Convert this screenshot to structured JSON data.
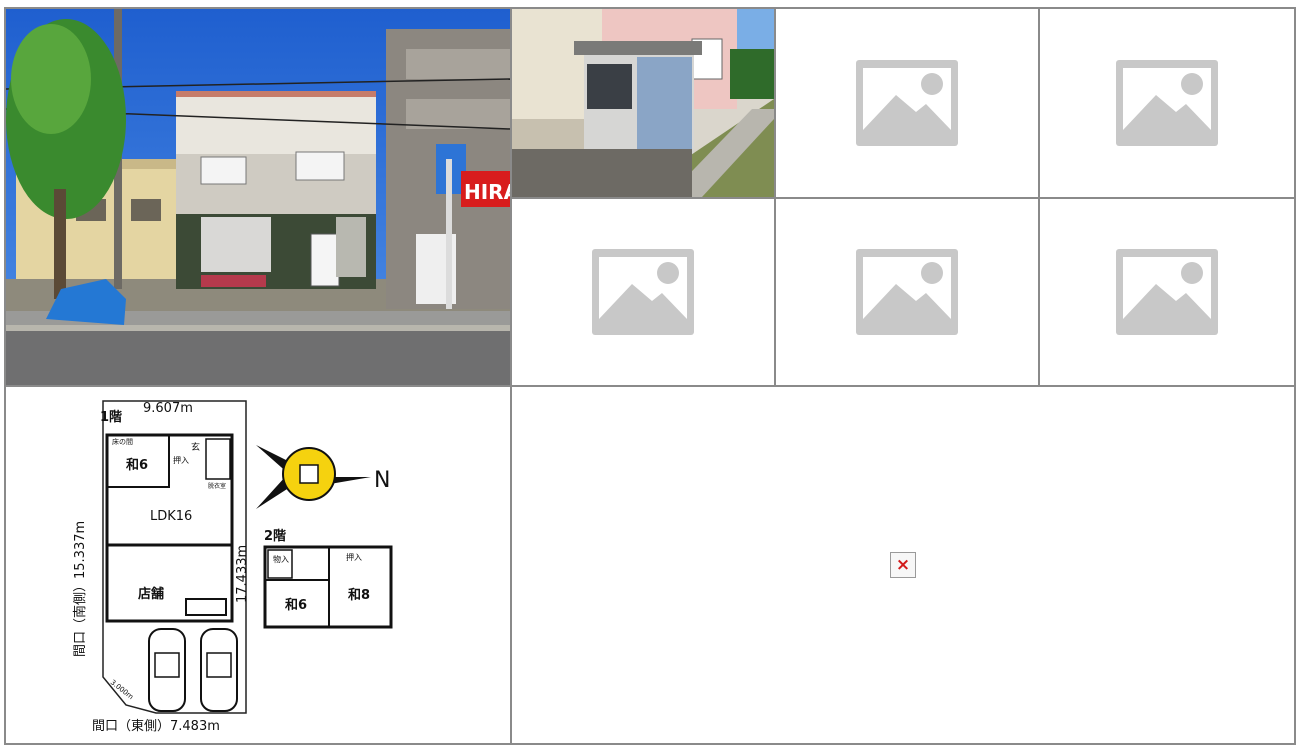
{
  "gallery": {
    "main_photo": {
      "alt": "building exterior photo",
      "signage": "HIRA"
    },
    "thumb_photo": {
      "alt": "side yard storage shed photo"
    },
    "placeholder_count": 5
  },
  "floor_plan": {
    "floor1_label": "1階",
    "floor2_label": "2階",
    "top_width": "9.607m",
    "left_side": "間口（南側）15.337m",
    "right_side": "17.433m",
    "bottom_side": "間口（東側）7.483m",
    "corner_cut": "3.000m",
    "room_washitsu6_f1": "和6",
    "room_ldk": "LDK16",
    "room_shop": "店舗",
    "room_tokonoma": "床の間",
    "room_oshiire_f1": "押入",
    "room_genkan": "玄",
    "room_misc": "脱衣室",
    "room_washitsu6_f2": "和6",
    "room_washitsu8": "和8",
    "room_oshiire_f2": "押入",
    "room_storage": "物入",
    "compass_letter": "N"
  },
  "broken_image": {
    "glyph": "×"
  }
}
